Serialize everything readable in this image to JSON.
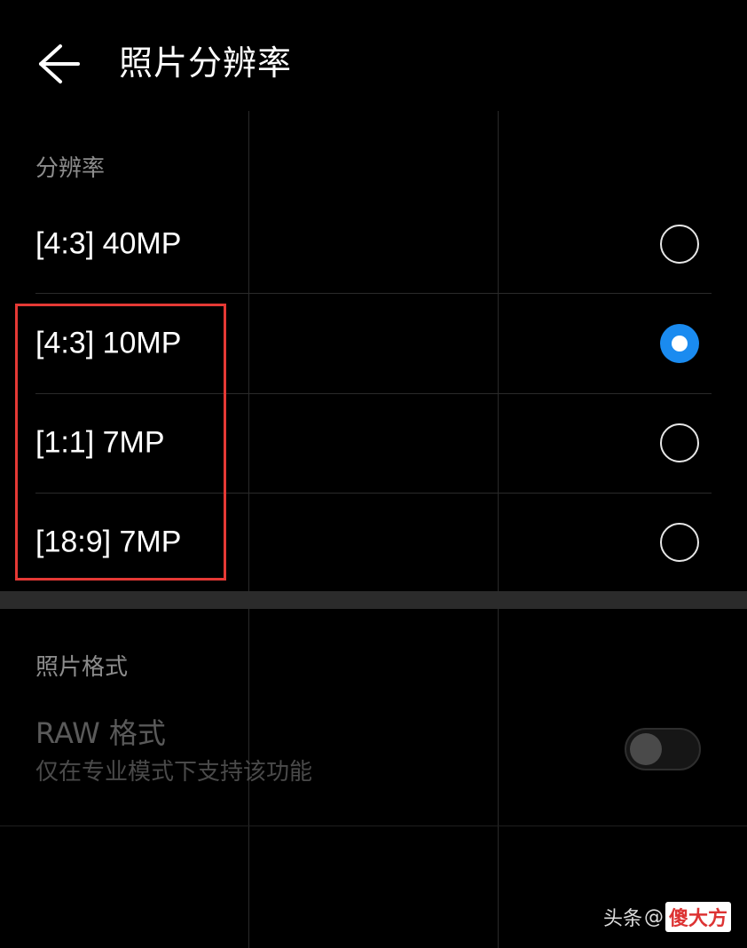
{
  "header": {
    "back_icon": "arrow-left-icon",
    "title": "照片分辨率"
  },
  "resolution_section": {
    "label": "分辨率",
    "options": [
      {
        "label": "[4:3] 40MP",
        "selected": false
      },
      {
        "label": "[4:3] 10MP",
        "selected": true
      },
      {
        "label": "[1:1] 7MP",
        "selected": false
      },
      {
        "label": "[18:9] 7MP",
        "selected": false
      }
    ]
  },
  "format_section": {
    "label": "照片格式",
    "raw": {
      "title": "RAW 格式",
      "subtitle": "仅在专业模式下支持该功能",
      "enabled": false
    }
  },
  "watermark": {
    "source": "头条",
    "at": "@",
    "badge": "傻大方"
  },
  "colors": {
    "accent": "#1a8bf0",
    "highlight": "#e53935",
    "background": "#000000"
  }
}
